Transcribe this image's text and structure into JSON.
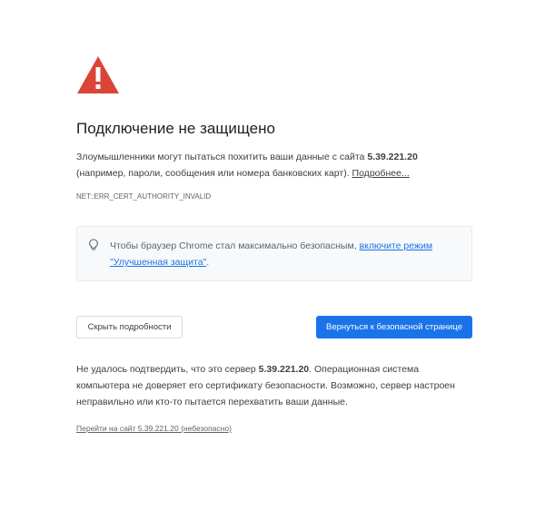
{
  "page": {
    "title": "Подключение не защищено",
    "warning_line1_prefix": "Злоумышленники могут пытаться похитить ваши данные с сайта ",
    "host": "5.39.221.20",
    "warning_line2": "(например, пароли, сообщения или номера банковских карт). ",
    "learn_more_link": "Подробнее...",
    "error_code": "NET::ERR_CERT_AUTHORITY_INVALID"
  },
  "info_box": {
    "icon": "lightbulb-icon",
    "text": "Чтобы браузер Chrome стал максимально безопасным, ",
    "link": "включите режим \"Улучшенная защита\"",
    "suffix": "."
  },
  "buttons": {
    "details_label": "Скрыть подробности",
    "back_label": "Вернуться к безопасной странице"
  },
  "details": {
    "prefix": "Не удалось подтвердить, что это сервер ",
    "host": "5.39.221.20",
    "suffix": ". Операционная система компьютера не доверяет его сертификату безопасности. Возможно, сервер настроен неправильно или кто-то пытается перехватить ваши данные.",
    "proceed_link": "Перейти на сайт 5.39.221.20 (небезопасно)"
  },
  "colors": {
    "warning_red": "#db4437",
    "primary_blue": "#1a73e8",
    "info_bg": "#f8f9fa"
  }
}
